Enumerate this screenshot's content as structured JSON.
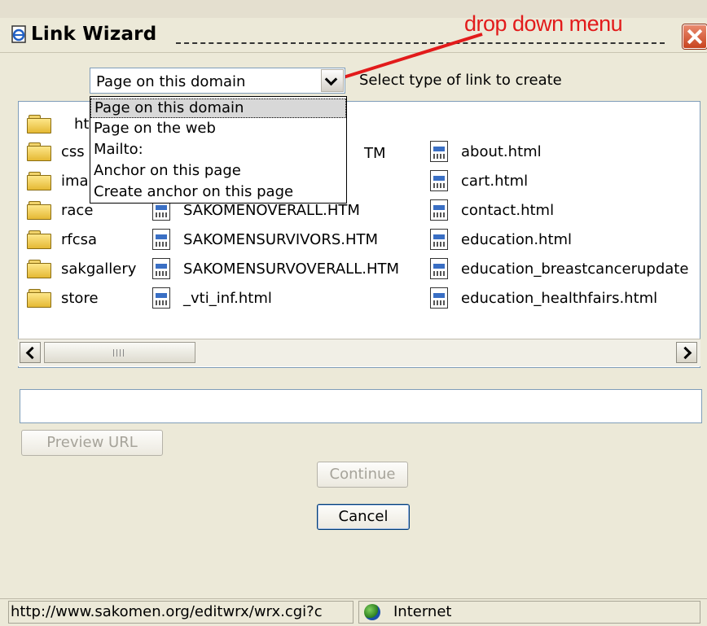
{
  "window": {
    "title": "Link Wizard"
  },
  "annotation": {
    "text": "drop down menu",
    "color": "#e21b1b"
  },
  "link_type": {
    "selected": "Page on this domain",
    "hint": "Select type of link to create",
    "options": [
      "Page on this domain",
      "Page on the web",
      "Mailto:",
      "Anchor on this page",
      "Create anchor on this page"
    ]
  },
  "files": {
    "col1": [
      {
        "icon": "folder-open-icon",
        "label": "htt"
      },
      {
        "icon": "folder-icon",
        "label": "css"
      },
      {
        "icon": "folder-icon",
        "label": "ima"
      },
      {
        "icon": "folder-icon",
        "label": "race"
      },
      {
        "icon": "folder-icon",
        "label": "rfcsa"
      },
      {
        "icon": "folder-icon",
        "label": "sakgallery"
      },
      {
        "icon": "folder-icon",
        "label": "store"
      }
    ],
    "col2": [
      {
        "icon": "html-file-icon",
        "label": "TM"
      },
      {
        "icon": "html-file-icon",
        "label": "SAKOMENOVERALL.HTM"
      },
      {
        "icon": "html-file-icon",
        "label": "SAKOMENSURVIVORS.HTM"
      },
      {
        "icon": "html-file-icon",
        "label": "SAKOMENSURVOVERALL.HTM"
      },
      {
        "icon": "html-file-icon",
        "label": "_vti_inf.html"
      }
    ],
    "col3": [
      {
        "icon": "html-file-icon",
        "label": "about.html"
      },
      {
        "icon": "html-file-icon",
        "label": "cart.html"
      },
      {
        "icon": "html-file-icon",
        "label": "contact.html"
      },
      {
        "icon": "html-file-icon",
        "label": "education.html"
      },
      {
        "icon": "html-file-icon",
        "label": "education_breastcancerupdate"
      },
      {
        "icon": "html-file-icon",
        "label": "education_healthfairs.html"
      }
    ]
  },
  "url_input": {
    "value": ""
  },
  "buttons": {
    "preview": "Preview URL",
    "continue": "Continue",
    "cancel": "Cancel"
  },
  "statusbar": {
    "url": "http://www.sakomen.org/editwrx/wrx.cgi?c",
    "zone": "Internet"
  }
}
